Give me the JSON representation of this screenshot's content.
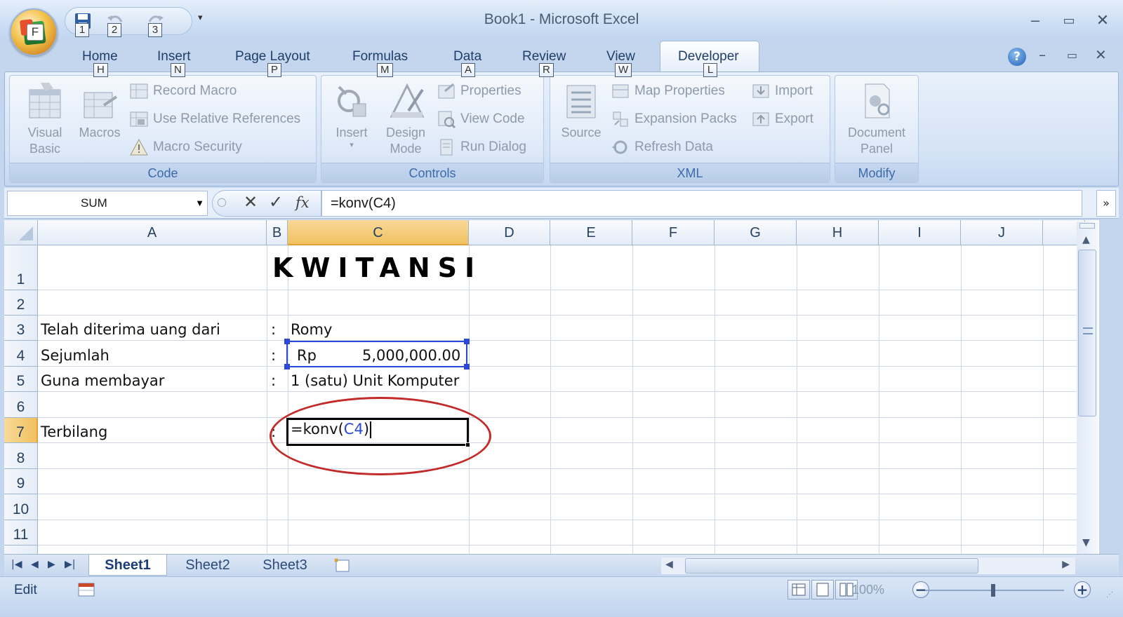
{
  "window": {
    "title": "Book1  -  Microsoft Excel"
  },
  "qat": {
    "keytips": [
      "1",
      "2",
      "3"
    ]
  },
  "tabs": [
    {
      "label": "Home",
      "keytip": "H"
    },
    {
      "label": "Insert",
      "keytip": "N"
    },
    {
      "label": "Page Layout",
      "keytip": "P"
    },
    {
      "label": "Formulas",
      "keytip": "M"
    },
    {
      "label": "Data",
      "keytip": "A"
    },
    {
      "label": "Review",
      "keytip": "R"
    },
    {
      "label": "View",
      "keytip": "W"
    },
    {
      "label": "Developer",
      "keytip": "L",
      "active": true
    }
  ],
  "ribbon": {
    "code": {
      "label": "Code",
      "visual_basic": "Visual\nBasic",
      "macros": "Macros",
      "record_macro": "Record Macro",
      "use_relative": "Use Relative References",
      "macro_security": "Macro Security"
    },
    "controls": {
      "label": "Controls",
      "insert": "Insert",
      "design_mode": "Design\nMode",
      "properties": "Properties",
      "view_code": "View Code",
      "run_dialog": "Run Dialog"
    },
    "xml": {
      "label": "XML",
      "source": "Source",
      "map_properties": "Map Properties",
      "expansion_packs": "Expansion Packs",
      "refresh_data": "Refresh Data",
      "import": "Import",
      "export": "Export"
    },
    "modify": {
      "label": "Modify",
      "document_panel": "Document\nPanel"
    }
  },
  "formula_bar": {
    "name_box": "SUM",
    "fx_label": "fx",
    "formula": "=konv(C4)"
  },
  "columns": [
    "A",
    "B",
    "C",
    "D",
    "E",
    "F",
    "G",
    "H",
    "I",
    "J"
  ],
  "rows": [
    "1",
    "2",
    "3",
    "4",
    "5",
    "6",
    "7",
    "8",
    "9",
    "10",
    "11"
  ],
  "cells": {
    "title": "KWITANSI",
    "a3": "Telah diterima uang dari",
    "a4": "Sejumlah",
    "a5": "Guna membayar",
    "a7": "Terbilang",
    "colon": ":",
    "c3": "Romy",
    "c4_prefix": "Rp",
    "c4_value": "5,000,000.00",
    "c5": "1 (satu) Unit Komputer",
    "c7_edit_prefix": "=konv(",
    "c7_edit_ref": "C4",
    "c7_edit_suffix": ")"
  },
  "sheets": [
    "Sheet1",
    "Sheet2",
    "Sheet3"
  ],
  "status": {
    "mode": "Edit",
    "zoom": "100%"
  }
}
